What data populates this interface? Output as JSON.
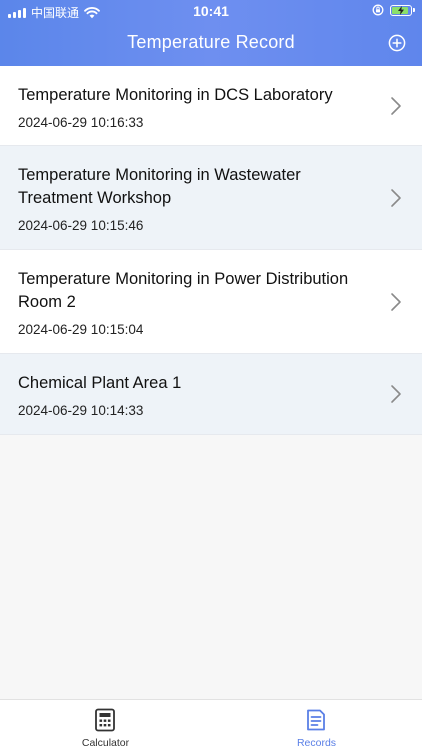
{
  "status_bar": {
    "carrier": "中国联通",
    "time": "10:41"
  },
  "header": {
    "title": "Temperature Record",
    "add_icon": "plus-circle-icon"
  },
  "records": [
    {
      "title": "Temperature Monitoring in DCS Laboratory",
      "date": "2024-06-29 10:16:33"
    },
    {
      "title": "Temperature Monitoring in Wastewater Treatment Workshop",
      "date": "2024-06-29 10:15:46"
    },
    {
      "title": "Temperature Monitoring in Power Distribution Room 2",
      "date": "2024-06-29 10:15:04"
    },
    {
      "title": "Chemical Plant Area 1",
      "date": "2024-06-29 10:14:33"
    }
  ],
  "tabbar": {
    "tabs": [
      {
        "label": "Calculator",
        "icon": "calculator-icon",
        "active": false
      },
      {
        "label": "Records",
        "icon": "document-icon",
        "active": true
      }
    ]
  },
  "colors": {
    "accent": "#5a7fe6",
    "header": "#6a8def",
    "row_tint": "#eef3f8",
    "battery": "#8be06b"
  }
}
